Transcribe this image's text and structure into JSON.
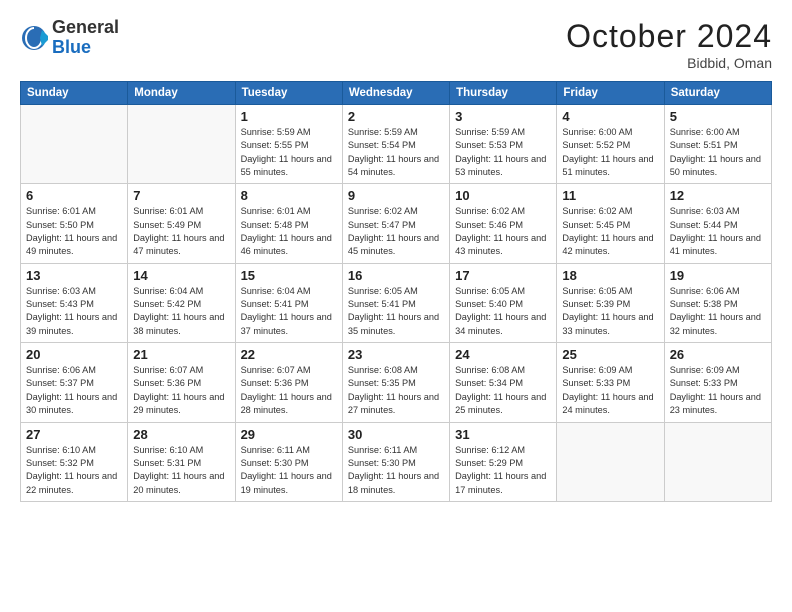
{
  "logo": {
    "general": "General",
    "blue": "Blue"
  },
  "header": {
    "month": "October 2024",
    "location": "Bidbid, Oman"
  },
  "days": [
    "Sunday",
    "Monday",
    "Tuesday",
    "Wednesday",
    "Thursday",
    "Friday",
    "Saturday"
  ],
  "weeks": [
    [
      {
        "day": "",
        "content": ""
      },
      {
        "day": "",
        "content": ""
      },
      {
        "day": "1",
        "content": "Sunrise: 5:59 AM\nSunset: 5:55 PM\nDaylight: 11 hours and 55 minutes."
      },
      {
        "day": "2",
        "content": "Sunrise: 5:59 AM\nSunset: 5:54 PM\nDaylight: 11 hours and 54 minutes."
      },
      {
        "day": "3",
        "content": "Sunrise: 5:59 AM\nSunset: 5:53 PM\nDaylight: 11 hours and 53 minutes."
      },
      {
        "day": "4",
        "content": "Sunrise: 6:00 AM\nSunset: 5:52 PM\nDaylight: 11 hours and 51 minutes."
      },
      {
        "day": "5",
        "content": "Sunrise: 6:00 AM\nSunset: 5:51 PM\nDaylight: 11 hours and 50 minutes."
      }
    ],
    [
      {
        "day": "6",
        "content": "Sunrise: 6:01 AM\nSunset: 5:50 PM\nDaylight: 11 hours and 49 minutes."
      },
      {
        "day": "7",
        "content": "Sunrise: 6:01 AM\nSunset: 5:49 PM\nDaylight: 11 hours and 47 minutes."
      },
      {
        "day": "8",
        "content": "Sunrise: 6:01 AM\nSunset: 5:48 PM\nDaylight: 11 hours and 46 minutes."
      },
      {
        "day": "9",
        "content": "Sunrise: 6:02 AM\nSunset: 5:47 PM\nDaylight: 11 hours and 45 minutes."
      },
      {
        "day": "10",
        "content": "Sunrise: 6:02 AM\nSunset: 5:46 PM\nDaylight: 11 hours and 43 minutes."
      },
      {
        "day": "11",
        "content": "Sunrise: 6:02 AM\nSunset: 5:45 PM\nDaylight: 11 hours and 42 minutes."
      },
      {
        "day": "12",
        "content": "Sunrise: 6:03 AM\nSunset: 5:44 PM\nDaylight: 11 hours and 41 minutes."
      }
    ],
    [
      {
        "day": "13",
        "content": "Sunrise: 6:03 AM\nSunset: 5:43 PM\nDaylight: 11 hours and 39 minutes."
      },
      {
        "day": "14",
        "content": "Sunrise: 6:04 AM\nSunset: 5:42 PM\nDaylight: 11 hours and 38 minutes."
      },
      {
        "day": "15",
        "content": "Sunrise: 6:04 AM\nSunset: 5:41 PM\nDaylight: 11 hours and 37 minutes."
      },
      {
        "day": "16",
        "content": "Sunrise: 6:05 AM\nSunset: 5:41 PM\nDaylight: 11 hours and 35 minutes."
      },
      {
        "day": "17",
        "content": "Sunrise: 6:05 AM\nSunset: 5:40 PM\nDaylight: 11 hours and 34 minutes."
      },
      {
        "day": "18",
        "content": "Sunrise: 6:05 AM\nSunset: 5:39 PM\nDaylight: 11 hours and 33 minutes."
      },
      {
        "day": "19",
        "content": "Sunrise: 6:06 AM\nSunset: 5:38 PM\nDaylight: 11 hours and 32 minutes."
      }
    ],
    [
      {
        "day": "20",
        "content": "Sunrise: 6:06 AM\nSunset: 5:37 PM\nDaylight: 11 hours and 30 minutes."
      },
      {
        "day": "21",
        "content": "Sunrise: 6:07 AM\nSunset: 5:36 PM\nDaylight: 11 hours and 29 minutes."
      },
      {
        "day": "22",
        "content": "Sunrise: 6:07 AM\nSunset: 5:36 PM\nDaylight: 11 hours and 28 minutes."
      },
      {
        "day": "23",
        "content": "Sunrise: 6:08 AM\nSunset: 5:35 PM\nDaylight: 11 hours and 27 minutes."
      },
      {
        "day": "24",
        "content": "Sunrise: 6:08 AM\nSunset: 5:34 PM\nDaylight: 11 hours and 25 minutes."
      },
      {
        "day": "25",
        "content": "Sunrise: 6:09 AM\nSunset: 5:33 PM\nDaylight: 11 hours and 24 minutes."
      },
      {
        "day": "26",
        "content": "Sunrise: 6:09 AM\nSunset: 5:33 PM\nDaylight: 11 hours and 23 minutes."
      }
    ],
    [
      {
        "day": "27",
        "content": "Sunrise: 6:10 AM\nSunset: 5:32 PM\nDaylight: 11 hours and 22 minutes."
      },
      {
        "day": "28",
        "content": "Sunrise: 6:10 AM\nSunset: 5:31 PM\nDaylight: 11 hours and 20 minutes."
      },
      {
        "day": "29",
        "content": "Sunrise: 6:11 AM\nSunset: 5:30 PM\nDaylight: 11 hours and 19 minutes."
      },
      {
        "day": "30",
        "content": "Sunrise: 6:11 AM\nSunset: 5:30 PM\nDaylight: 11 hours and 18 minutes."
      },
      {
        "day": "31",
        "content": "Sunrise: 6:12 AM\nSunset: 5:29 PM\nDaylight: 11 hours and 17 minutes."
      },
      {
        "day": "",
        "content": ""
      },
      {
        "day": "",
        "content": ""
      }
    ]
  ]
}
